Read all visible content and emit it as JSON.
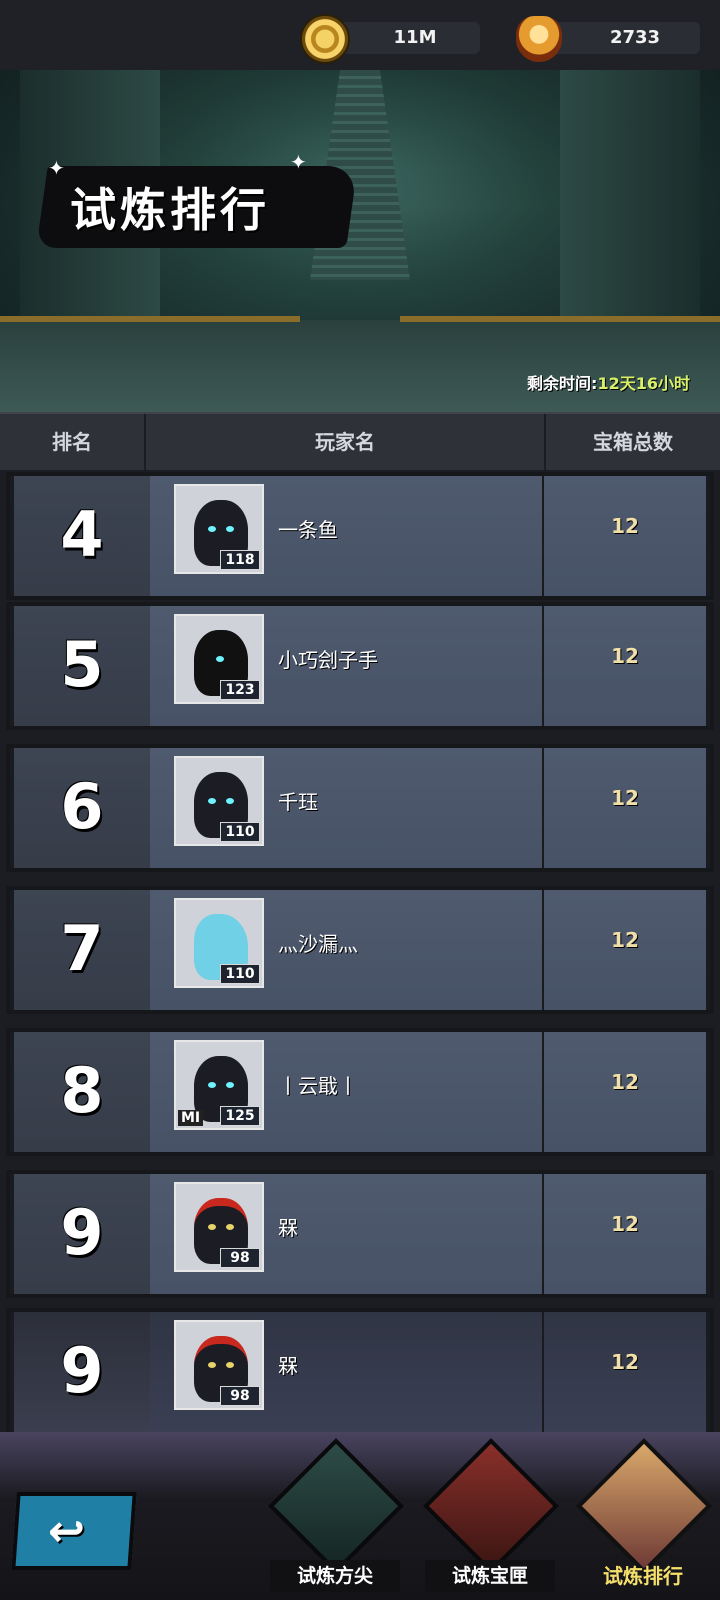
{
  "resources": {
    "gold": {
      "icon": "gold-coin-icon",
      "value": "11M"
    },
    "trophy": {
      "icon": "trophy-icon",
      "value": "2733"
    }
  },
  "banner": {
    "title": "试炼排行",
    "remaining_label": "剩余时间:",
    "remaining_value": "12天16小时"
  },
  "table": {
    "headers": {
      "rank": "排名",
      "player": "玩家名",
      "chests": "宝箱总数"
    },
    "rows": [
      {
        "rank": "4",
        "name": "一条鱼",
        "level": "118",
        "chests": "12",
        "avatar": "horned-white-hair-avatar"
      },
      {
        "rank": "5",
        "name": "小巧刽子手",
        "level": "123",
        "chests": "12",
        "avatar": "black-cyan-helmet-avatar"
      },
      {
        "rank": "6",
        "name": "千珏",
        "level": "110",
        "chests": "12",
        "avatar": "horned-white-hair-avatar"
      },
      {
        "rank": "7",
        "name": "灬沙漏灬",
        "level": "110",
        "chests": "12",
        "avatar": "blue-dino-avatar"
      },
      {
        "rank": "8",
        "name": "丨云戢丨",
        "level": "125",
        "chests": "12",
        "avatar": "pink-hat-girl-avatar",
        "badge": "MI"
      },
      {
        "rank": "9",
        "name": "槑",
        "level": "98",
        "chests": "12",
        "avatar": "red-headdress-avatar"
      },
      {
        "rank": "9",
        "name": "槑",
        "level": "98",
        "chests": "12",
        "avatar": "red-headdress-avatar"
      }
    ]
  },
  "nav": {
    "back_icon": "back-arrow-icon",
    "tabs": [
      {
        "label": "试炼方尖",
        "active": false
      },
      {
        "label": "试炼宝匣",
        "active": false
      },
      {
        "label": "试炼排行",
        "active": true
      }
    ]
  },
  "colors": {
    "remaining_time": "#d8ef6a",
    "chest_count": "#f0dfa8",
    "active_tab": "#f5e06b"
  }
}
